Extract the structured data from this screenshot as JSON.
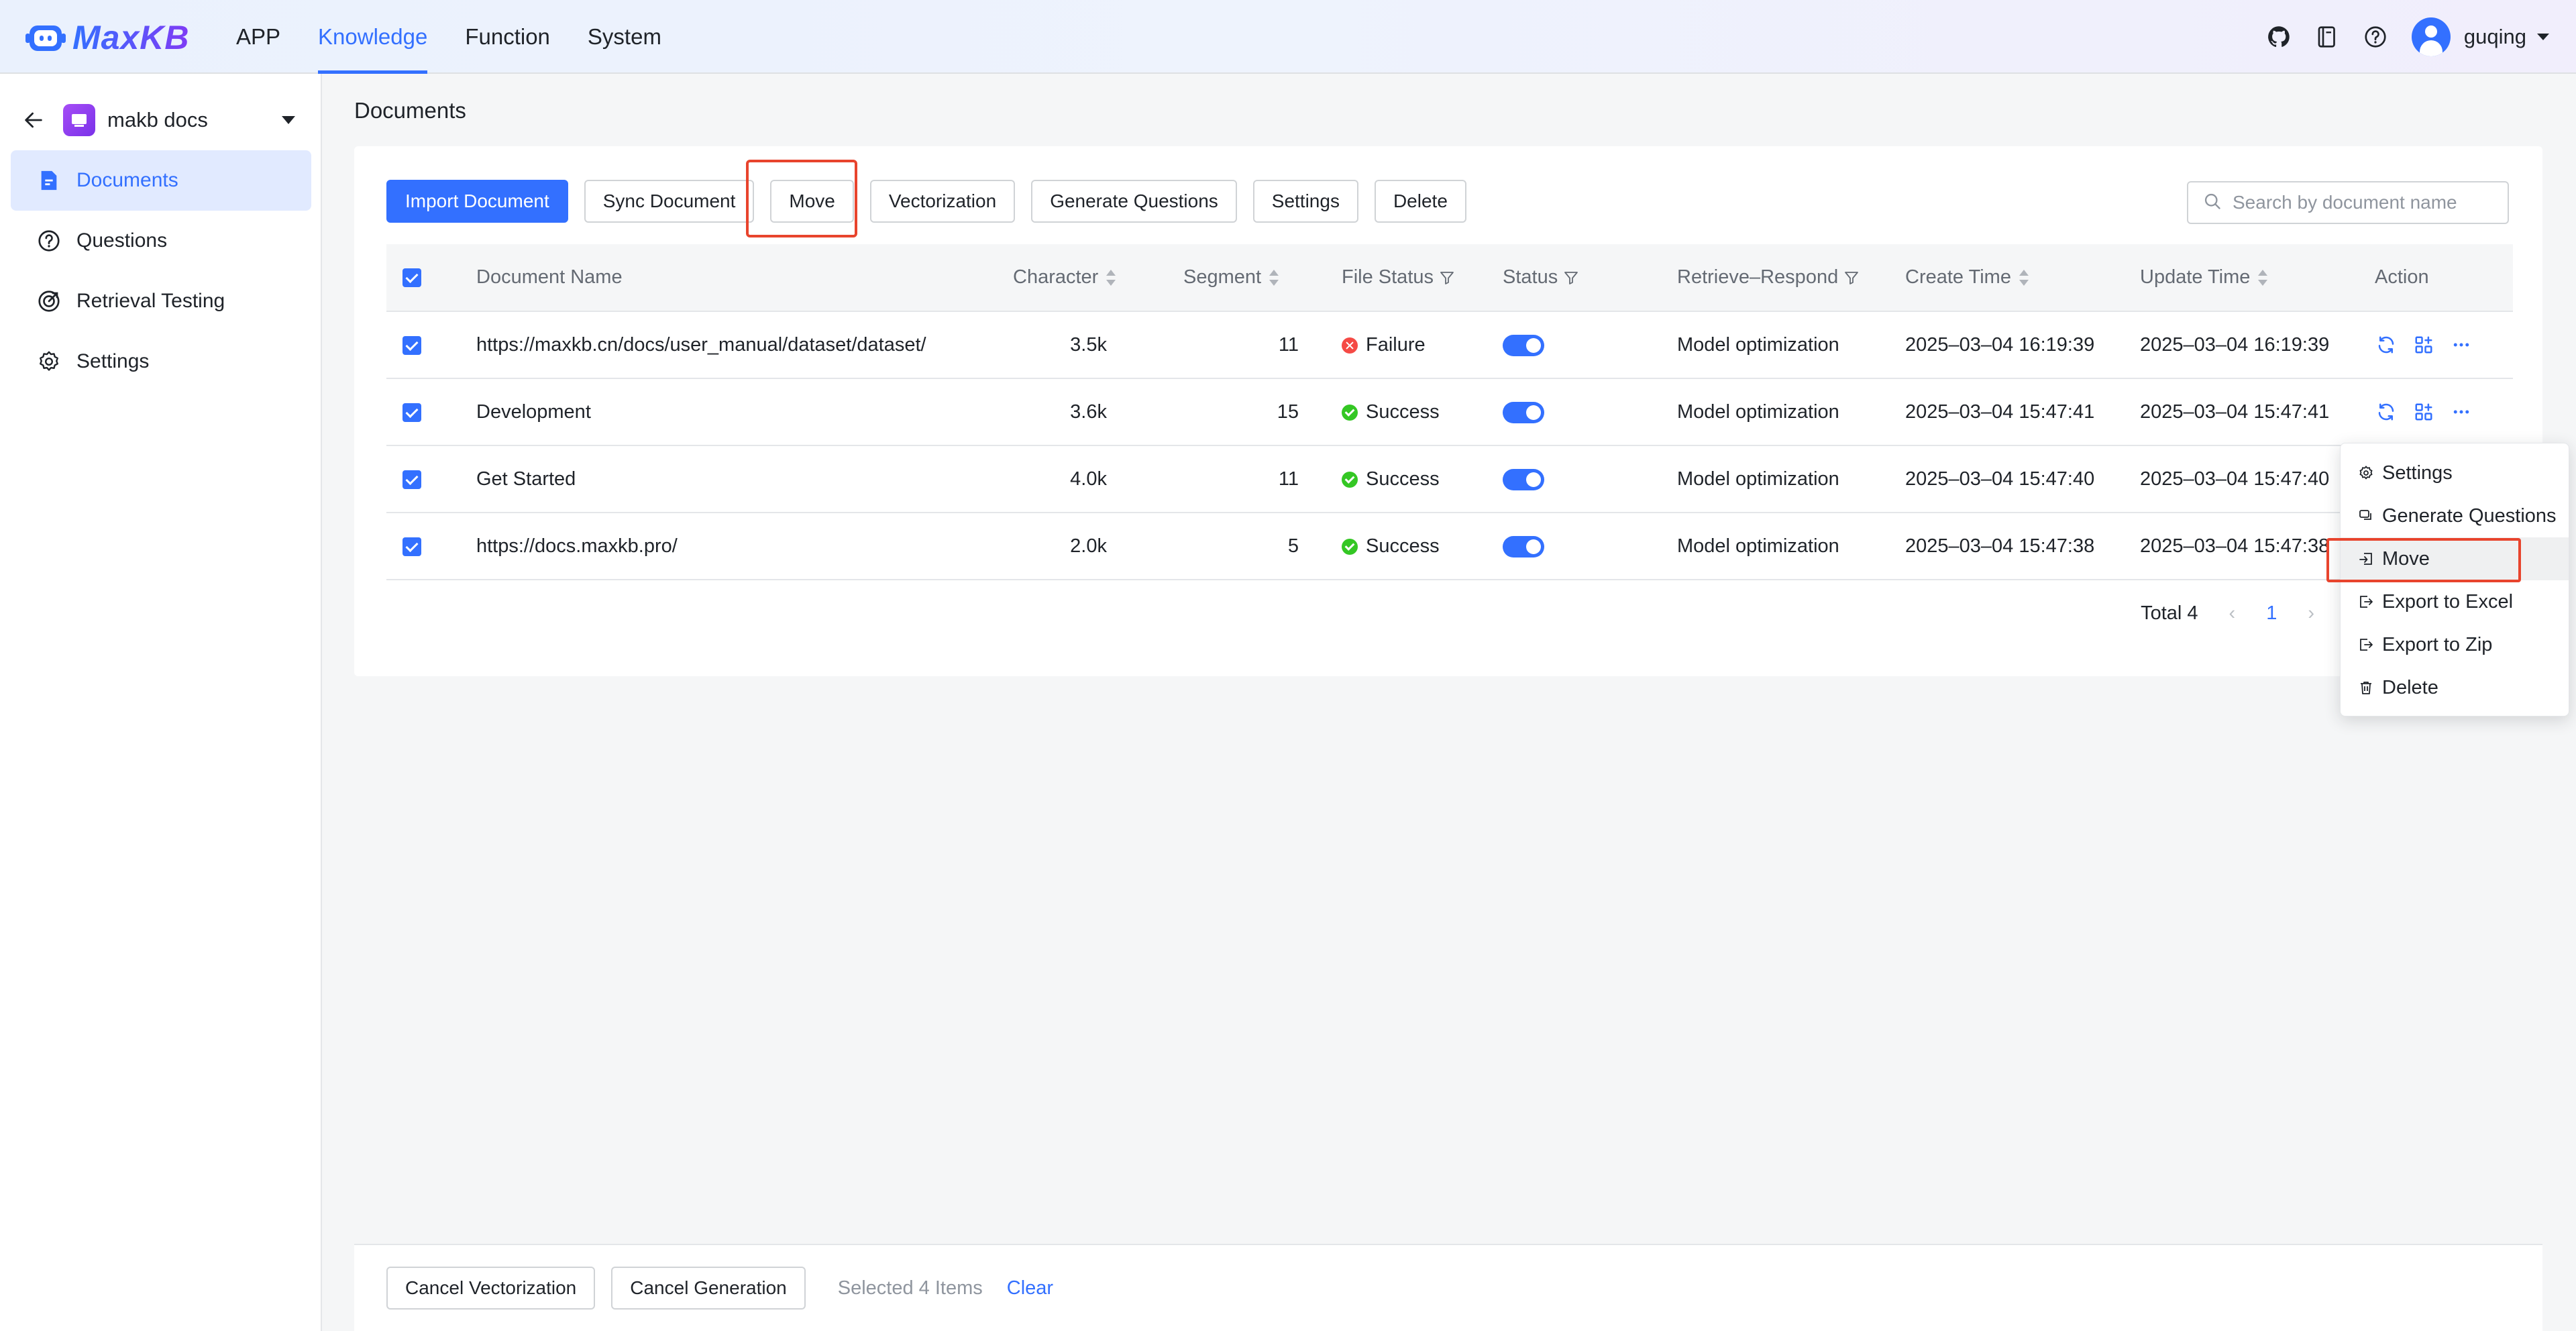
{
  "header": {
    "logo_text": "MaxKB",
    "nav": [
      {
        "label": "APP",
        "active": false
      },
      {
        "label": "Knowledge",
        "active": true
      },
      {
        "label": "Function",
        "active": false
      },
      {
        "label": "System",
        "active": false
      }
    ],
    "icons": [
      "github-icon",
      "book-icon",
      "help-icon"
    ],
    "username": "guqing"
  },
  "sidebar": {
    "knowledge_name": "makb docs",
    "items": [
      {
        "label": "Documents",
        "icon": "document-icon",
        "active": true
      },
      {
        "label": "Questions",
        "icon": "question-icon",
        "active": false
      },
      {
        "label": "Retrieval Testing",
        "icon": "target-icon",
        "active": false
      },
      {
        "label": "Settings",
        "icon": "gear-icon",
        "active": false
      }
    ]
  },
  "main": {
    "title": "Documents",
    "toolbar": {
      "import": "Import Document",
      "sync": "Sync Document",
      "move": "Move",
      "vectorization": "Vectorization",
      "generate": "Generate Questions",
      "settings": "Settings",
      "delete": "Delete"
    },
    "search_placeholder": "Search by document name",
    "columns": {
      "name": "Document Name",
      "character": "Character",
      "segment": "Segment",
      "file_status": "File Status",
      "status": "Status",
      "retrieve": "Retrieve–Respond",
      "create": "Create Time",
      "update": "Update Time",
      "action": "Action"
    },
    "rows": [
      {
        "name": "https://maxkb.cn/docs/user_manual/dataset/dataset/",
        "character": "3.5k",
        "segment": "11",
        "file_status": "Failure",
        "status_ok": false,
        "enabled": true,
        "retrieve": "Model optimization",
        "create": "2025–03–04 16:19:39",
        "update": "2025–03–04 16:19:39"
      },
      {
        "name": "Development",
        "character": "3.6k",
        "segment": "15",
        "file_status": "Success",
        "status_ok": true,
        "enabled": true,
        "retrieve": "Model optimization",
        "create": "2025–03–04 15:47:41",
        "update": "2025–03–04 15:47:41"
      },
      {
        "name": "Get Started",
        "character": "4.0k",
        "segment": "11",
        "file_status": "Success",
        "status_ok": true,
        "enabled": true,
        "retrieve": "Model optimization",
        "create": "2025–03–04 15:47:40",
        "update": "2025–03–04 15:47:40"
      },
      {
        "name": "https://docs.maxkb.pro/",
        "character": "2.0k",
        "segment": "5",
        "file_status": "Success",
        "status_ok": true,
        "enabled": true,
        "retrieve": "Model optimization",
        "create": "2025–03–04 15:47:38",
        "update": "2025–03–04 15:47:38"
      }
    ],
    "pagination": {
      "total": "Total 4",
      "current": "1"
    }
  },
  "dropdown": {
    "items": [
      {
        "label": "Settings",
        "icon": "gear-icon"
      },
      {
        "label": "Generate Questions",
        "icon": "chat-icon"
      },
      {
        "label": "Move",
        "icon": "move-icon"
      },
      {
        "label": "Export to Excel",
        "icon": "export-icon"
      },
      {
        "label": "Export to Zip",
        "icon": "export-icon"
      },
      {
        "label": "Delete",
        "icon": "trash-icon"
      }
    ],
    "hovered": "Move"
  },
  "bottom_bar": {
    "cancel_vectorization": "Cancel Vectorization",
    "cancel_generation": "Cancel Generation",
    "selected": "Selected 4 Items",
    "clear": "Clear"
  },
  "colors": {
    "accent": "#3370ff",
    "highlight": "#e8442d",
    "success": "#34c724",
    "failure": "#f54a45"
  }
}
